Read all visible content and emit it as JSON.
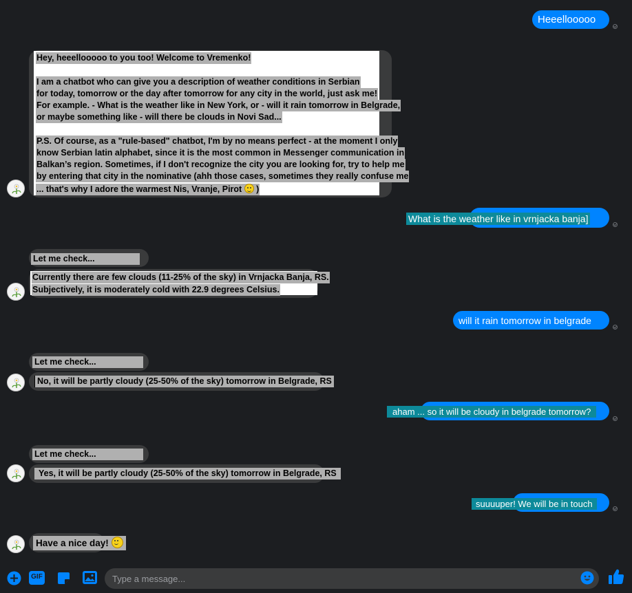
{
  "colors": {
    "background": "#1c1e21",
    "outgoing_bubble": "#0084ff",
    "outgoing_highlight": "#0d8a9a",
    "incoming_bubble": "#3a3b3c",
    "incoming_highlight": "#b0b0b0",
    "composer_icons": "#0084ff"
  },
  "messages": {
    "m1": {
      "text": "Heeellooooo"
    },
    "m2": {
      "lines": [
        "Hey, heeellooooo to you too! Welcome to Vremenko!",
        "",
        "I am a chatbot who can give you a description of weather conditions in Serbian",
        "for today, tomorrow or the day after tomorrow for any city in the world, just ask me!",
        "For example. - What is the weather like in New York, or - will it rain tomorrow in Belgrade,",
        "or maybe something like - will there be clouds in Novi Sad...",
        "",
        "P.S. Of course, as a \"rule-based\" chatbot, I'm by no means perfect - at the moment I only",
        "know Serbian latin alphabet, since it is the most common in Messenger communication in",
        "Balkan’s region. Sometimes, if I don't recognize the city you are looking for, try to help me",
        "by entering that city in the nominative (ahh those cases, sometimes they really confuse me",
        "... that's why I adore the warmest Nis, Vranje, Pirot",
        ")"
      ]
    },
    "m3": {
      "text": "What is the weather like in vrnjacka banja]"
    },
    "m4": {
      "text": "Let me check..."
    },
    "m5": {
      "lines": [
        "Currently there are few clouds (11-25% of the sky) in Vrnjacka Banja, RS.",
        "Subjectively, it is moderately cold with 22.9 degrees Celsius."
      ]
    },
    "m6": {
      "text": "will it rain tomorrow in belgrade"
    },
    "m7": {
      "text": "Let me check..."
    },
    "m8": {
      "text": "No, it will be partly cloudy (25-50% of the sky) tomorrow in Belgrade, RS"
    },
    "m9": {
      "text": "aham ... so it will be cloudy in belgrade tomorrow?"
    },
    "m10": {
      "text": "Let me check..."
    },
    "m11": {
      "text": "Yes, it will be partly cloudy (25-50% of the sky) tomorrow in Belgrade, RS"
    },
    "m12": {
      "text": "suuuuper! We will be in touch"
    },
    "m13": {
      "text": "Have a nice day!"
    }
  },
  "composer": {
    "placeholder": "Type a message...",
    "icons": [
      "plus-icon",
      "gif-icon",
      "sticker-icon",
      "image-icon",
      "emoji-icon",
      "thumbs-up-icon"
    ],
    "gif_label": "GIF"
  }
}
